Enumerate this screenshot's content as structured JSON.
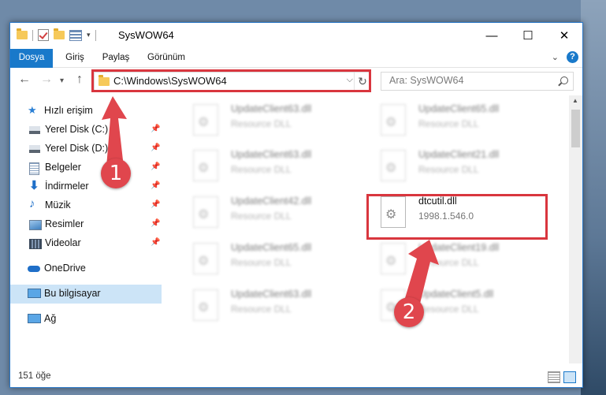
{
  "window": {
    "title": "SysWOW64",
    "controls": {
      "minimize": "—",
      "maximize": "☐",
      "close": "✕"
    }
  },
  "ribbon": {
    "tabs": [
      "Dosya",
      "Giriş",
      "Paylaş",
      "Görünüm"
    ],
    "help": "?"
  },
  "navigation": {
    "address": "C:\\Windows\\SysWOW64",
    "search_placeholder": "Ara: SysWOW64"
  },
  "sidebar": {
    "quick_access": "Hızlı erişim",
    "pinned": [
      {
        "label": "Yerel Disk (C:)",
        "icon": "drive-icon"
      },
      {
        "label": "Yerel Disk (D:)",
        "icon": "drive-icon"
      },
      {
        "label": "Belgeler",
        "icon": "documents-icon"
      },
      {
        "label": "İndirmeler",
        "icon": "download-icon"
      },
      {
        "label": "Müzik",
        "icon": "music-icon"
      },
      {
        "label": "Resimler",
        "icon": "pictures-icon"
      },
      {
        "label": "Videolar",
        "icon": "videos-icon"
      }
    ],
    "onedrive": "OneDrive",
    "this_pc": "Bu bilgisayar",
    "network": "Ağ"
  },
  "files": [
    {
      "name": "UpdateClient63.dll",
      "sub": "Resource DLL",
      "blurred": true
    },
    {
      "name": "UpdateClient65.dll",
      "sub": "Resource DLL",
      "blurred": true
    },
    {
      "name": "UpdateClient63.dll",
      "sub": "Resource DLL",
      "blurred": true
    },
    {
      "name": "UpdateClient21.dll",
      "sub": "Resource DLL",
      "blurred": true
    },
    {
      "name": "UpdateClient42.dll",
      "sub": "Resource DLL",
      "blurred": true
    },
    {
      "name": "dtcutil.dll",
      "sub": "1998.1.546.0",
      "blurred": false
    },
    {
      "name": "UpdateClient65.dll",
      "sub": "Resource DLL",
      "blurred": true
    },
    {
      "name": "UpdateClient19.dll",
      "sub": "Resource DLL",
      "blurred": true
    },
    {
      "name": "UpdateClient63.dll",
      "sub": "Resource DLL",
      "blurred": true
    },
    {
      "name": "UpdateClient5.dll",
      "sub": "Resource DLL",
      "blurred": true
    }
  ],
  "status": {
    "item_count": "151 öğe"
  },
  "annotations": {
    "marker1": "1",
    "marker2": "2",
    "color": "#d9363e"
  }
}
